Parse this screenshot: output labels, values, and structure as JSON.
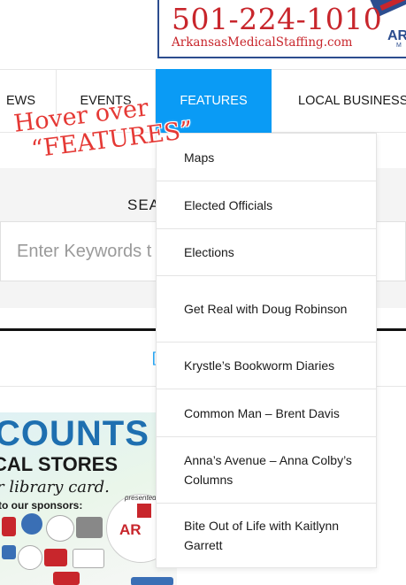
{
  "ad": {
    "phone": "501-224-1010",
    "url": "ArkansasMedicalStaffing.com",
    "logo": "AR",
    "logo_sub": "M"
  },
  "nav": {
    "items": [
      {
        "label": "NEWS",
        "shown": "EWS"
      },
      {
        "label": "EVENTS"
      },
      {
        "label": "FEATURES",
        "active": true
      },
      {
        "label": "LOCAL BUSINESSES",
        "shown": "LOCAL BUSINESSE"
      }
    ]
  },
  "annotation": {
    "line1": "Hover over",
    "line2": "“FEATURES”",
    "color": "#e53935"
  },
  "search": {
    "heading": "SEA",
    "placeholder": "Enter Keywords t"
  },
  "partial_link": "[",
  "dropdown": {
    "items": [
      {
        "label": "Maps"
      },
      {
        "label": "Elected Officials"
      },
      {
        "label": "Elections"
      },
      {
        "label": "Get Real with Doug Robinson"
      },
      {
        "label": "Krystle’s Bookworm Diaries"
      },
      {
        "label": "Common Man – Brent Davis"
      },
      {
        "label": "Anna’s Avenue – Anna Colby’s Columns"
      },
      {
        "label": "Bite Out of Life with Kaitlynn Garrett"
      }
    ]
  },
  "promo": {
    "title": "COUNTS",
    "subtitle": "CAL STORES",
    "script": "r library card.",
    "sponsors_label": "to our sponsors:",
    "badge_pre": "presented",
    "badge_text": "AR"
  },
  "colors": {
    "accent": "#0a9bf5",
    "ad_red": "#c8262c",
    "ad_blue": "#2c4d8f"
  }
}
